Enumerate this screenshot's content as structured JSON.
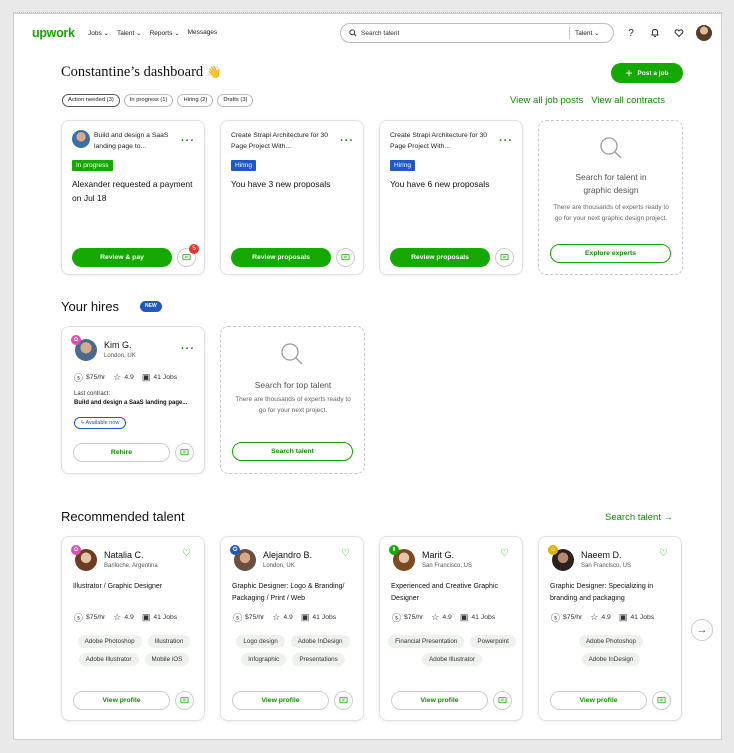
{
  "nav": {
    "logo": "upwork",
    "links": [
      "Jobs ⌄",
      "Talent ⌄",
      "Reports ⌄",
      "Messages"
    ],
    "search_placeholder": "Search talent",
    "search_scope": "Talent ⌄",
    "icons": [
      "help-icon",
      "bell-icon",
      "heart-icon",
      "avatar"
    ]
  },
  "dashboard": {
    "title": "Constantine’s dashboard",
    "wave": "👋",
    "post_job": "Post a job",
    "filters": [
      "Action needed (3)",
      "In progress (1)",
      "Hiring (2)",
      "Drafts (3)"
    ],
    "view_all_posts": "View all job posts",
    "view_all_contracts": "View all contracts"
  },
  "jobs": [
    {
      "title": "Build and design a SaaS landing page to...",
      "status": "In progress",
      "message": "Alexander requested a payment on Jul 18",
      "action": "Review & pay",
      "unread": "5"
    },
    {
      "title": "Create Strapi Architecture for 30 Page Project With...",
      "status": "Hiring",
      "message": "You have 3 new proposals",
      "action": "Review proposals"
    },
    {
      "title": "Create Strapi Architecture for 30 Page Project With...",
      "status": "Hiring",
      "message": "You have 6 new proposals",
      "action": "Review proposals"
    }
  ],
  "empty_job": {
    "title": "Search for talent in graphic design",
    "text": "There are thousands of experts ready to go for your next graphic design project.",
    "action": "Explore experts"
  },
  "hires": {
    "title": "Your hires",
    "badge": "NEW",
    "hire": {
      "name": "Kim G.",
      "location": "London, UK",
      "rate": "$75/hr",
      "rating": "4.9",
      "jobs": "41 Jobs",
      "contract_label": "Last contract:",
      "contract": "Build and design a SaaS landing page...",
      "availability": "Available now",
      "action": "Rehire"
    },
    "empty": {
      "title": "Search for top talent",
      "text": "There are thousands of experts ready to go for your next project.",
      "action": "Search talent"
    }
  },
  "recommended": {
    "title": "Recommended talent",
    "link": "Search talent",
    "people": [
      {
        "name": "Natalia C.",
        "location": "Bariloche, Argentina",
        "role": "Illustrator / Graphic Designer",
        "rate": "$75/hr",
        "rating": "4.9",
        "jobs": "41 Jobs",
        "skills": [
          "Adobe Photoshop",
          "Illustration",
          "Adobe Illustrator",
          "Mobile iOS"
        ],
        "action": "View profile",
        "badge_color": "#e44bb3"
      },
      {
        "name": "Alejandro B.",
        "location": "London, UK",
        "role": "Graphic Designer: Logo & Branding/ Packaging / Print / Web",
        "rate": "$75/hr",
        "rating": "4.9",
        "jobs": "41 Jobs",
        "skills": [
          "Logo design",
          "Adobe InDesign",
          "Infographic",
          "Presentations"
        ],
        "action": "View profile",
        "badge_color": "#1f57c3"
      },
      {
        "name": "Marit G.",
        "location": "San Francisco, US",
        "role": "Experienced and Creative Graphic Designer",
        "rate": "$75/hr",
        "rating": "4.9",
        "jobs": "41 Jobs",
        "skills": [
          "Financial Presentation",
          "Powerpoint",
          "Adobe Illustrator"
        ],
        "action": "View profile",
        "badge_color": "#14a800"
      },
      {
        "name": "Naeem D.",
        "location": "San Francisco, US",
        "role": "Graphic Designer: Specializing in branding and packaging",
        "rate": "$75/hr",
        "rating": "4.9",
        "jobs": "41 Jobs",
        "skills": [
          "Adobe Photoshop",
          "Adobe InDesign"
        ],
        "action": "View profile",
        "badge_color": "#e0b100"
      }
    ]
  },
  "colors": {
    "brand": "#14a800",
    "link": "#108a00",
    "hiring": "#1f57c3",
    "notification": "#e3342f"
  }
}
